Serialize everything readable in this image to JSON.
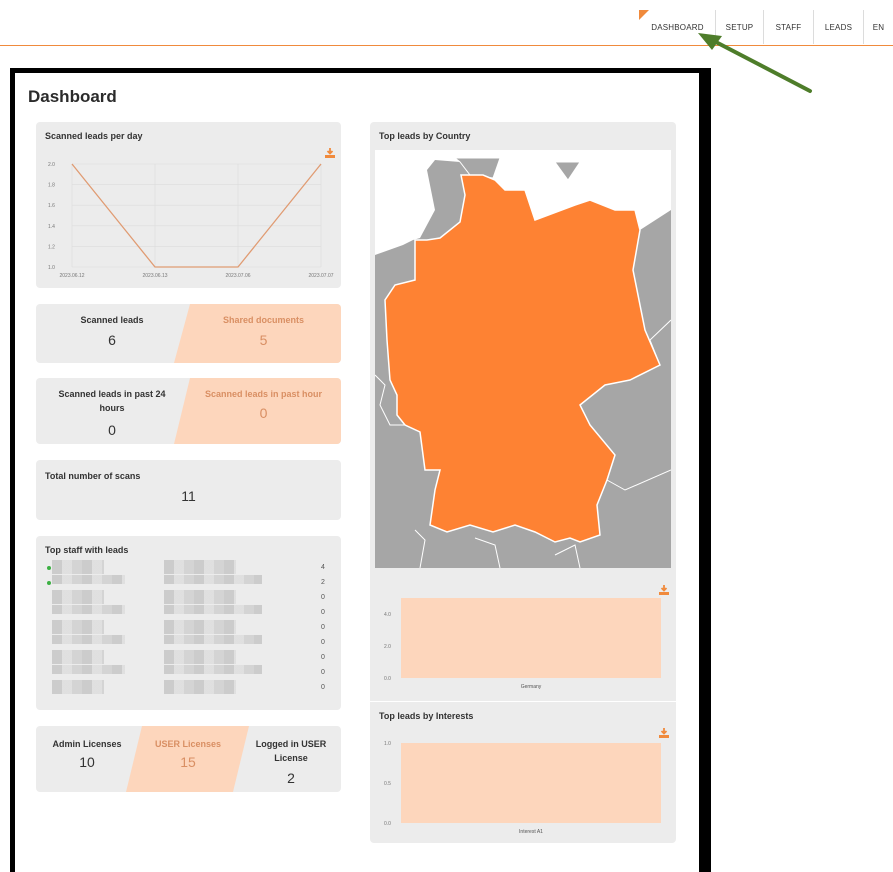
{
  "nav": {
    "items": [
      {
        "label": "DASHBOARD"
      },
      {
        "label": "SETUP"
      },
      {
        "label": "STAFF"
      },
      {
        "label": "LEADS"
      },
      {
        "label": "EN"
      }
    ]
  },
  "colors": {
    "accent": "#f08a3c",
    "accent_light": "#fdd6bc",
    "map_gray": "#a6a6a6",
    "arrow": "#4e7d2a"
  },
  "page": {
    "title": "Dashboard"
  },
  "scanned_per_day": {
    "title": "Scanned leads per day",
    "chart_data": {
      "type": "line",
      "x": [
        "2023.06.12",
        "2023.06.13",
        "2023.07.06",
        "2023.07.07"
      ],
      "series": [
        {
          "values": [
            2.0,
            1.0,
            1.0,
            2.0
          ]
        }
      ],
      "ylim": [
        1.0,
        2.0
      ],
      "yticks": [
        "2.0",
        "1.8",
        "1.6",
        "1.4",
        "1.2",
        "1.0"
      ],
      "grid": true
    }
  },
  "stats1": {
    "left_label": "Scanned leads",
    "left_value": "6",
    "right_label": "Shared documents",
    "right_value": "5"
  },
  "stats2": {
    "left_label": "Scanned leads in past 24 hours",
    "left_value": "0",
    "right_label": "Scanned leads in past hour",
    "right_value": "0"
  },
  "stats3": {
    "label": "Total number of scans",
    "value": "11"
  },
  "top_staff": {
    "title": "Top staff with leads",
    "counts": [
      "4",
      "2",
      "0",
      "0",
      "0",
      "0",
      "0",
      "0",
      "0"
    ]
  },
  "licenses": {
    "admin_label": "Admin Licenses",
    "admin_value": "10",
    "user_label": "USER Licenses",
    "user_value": "15",
    "logged_label": "Logged in USER License",
    "logged_value": "2"
  },
  "top_country": {
    "title": "Top leads by Country",
    "chart_data": {
      "type": "bar",
      "categories": [
        "Germany"
      ],
      "values": [
        5
      ],
      "yticks": [
        "4.0",
        "2.0",
        "0.0"
      ],
      "ylim": [
        0,
        5
      ]
    }
  },
  "top_interests": {
    "title": "Top leads by Interests",
    "chart_data": {
      "type": "bar",
      "categories": [
        "Interest A1"
      ],
      "values": [
        1.0
      ],
      "yticks": [
        "1.0",
        "0.5",
        "0.0"
      ],
      "ylim": [
        0,
        1.0
      ]
    }
  }
}
